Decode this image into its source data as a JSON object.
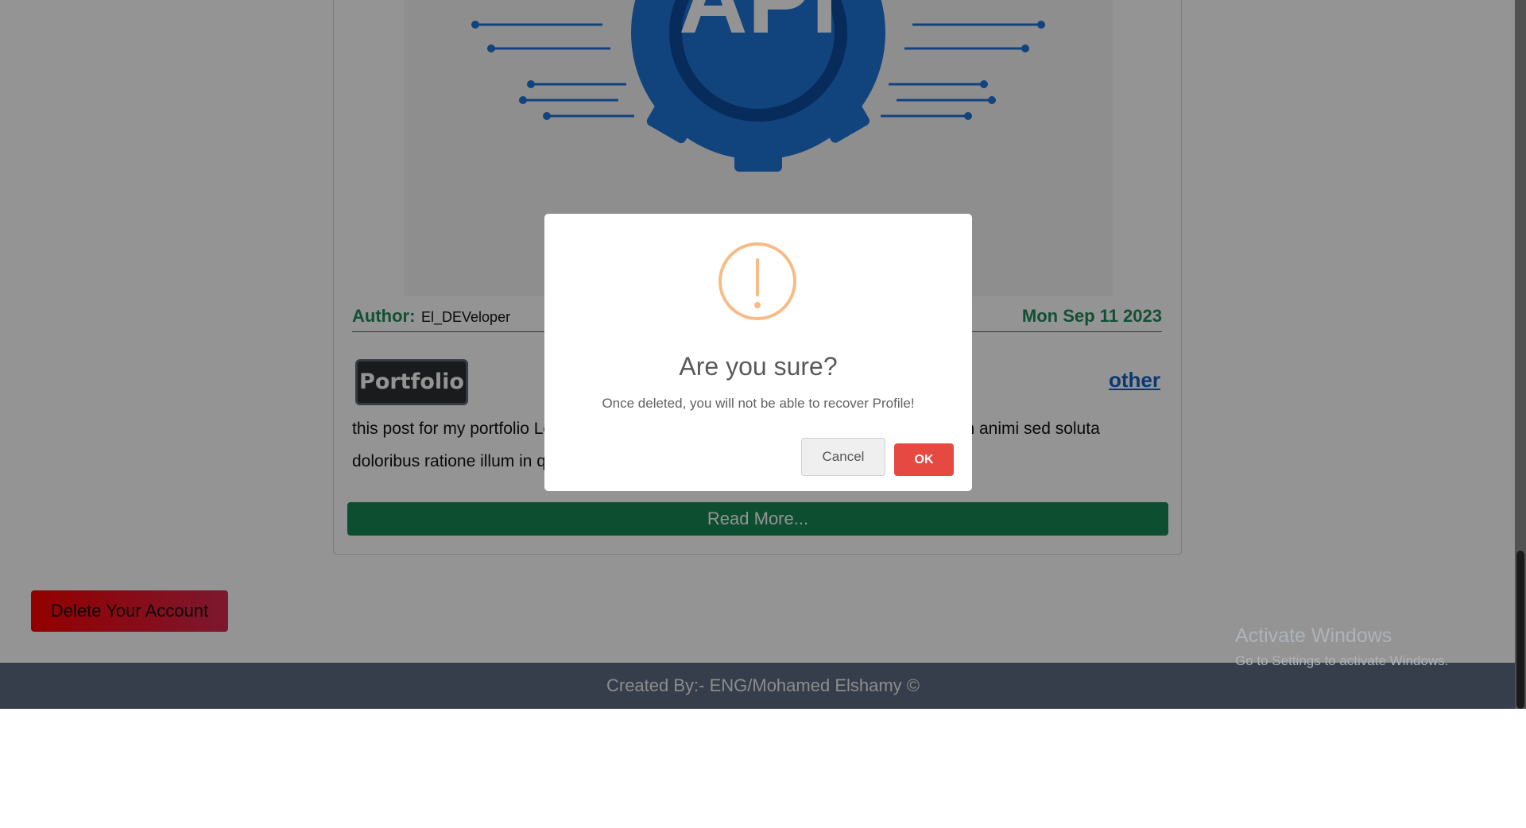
{
  "post": {
    "image_alt": "API",
    "author_label": "Author:",
    "author_name": "El_DEVeloper",
    "date": "Mon Sep 11 2023",
    "category": "Portfolio",
    "tag": "other",
    "text": "this post for my portfolio Lorem ipsum dolor sit amet consectetur adipisicing elit. Non animi sed soluta doloribus ratione illum in quasi? Dolorum earu...",
    "read_more": "Read More..."
  },
  "account": {
    "delete_label": "Delete Your Account"
  },
  "footer": {
    "text": "Created By:- ENG/Mohamed Elshamy ©"
  },
  "watermark": {
    "title": "Activate Windows",
    "subtitle": "Go to Settings to activate Windows."
  },
  "dialog": {
    "icon": "warning-icon",
    "title": "Are you sure?",
    "message": "Once deleted, you will not be able to recover Profile!",
    "cancel_label": "Cancel",
    "ok_label": "OK"
  },
  "colors": {
    "accent_green": "#198754",
    "link_blue": "#1760c4",
    "danger": "#e64942",
    "warning": "#f8bb86"
  }
}
